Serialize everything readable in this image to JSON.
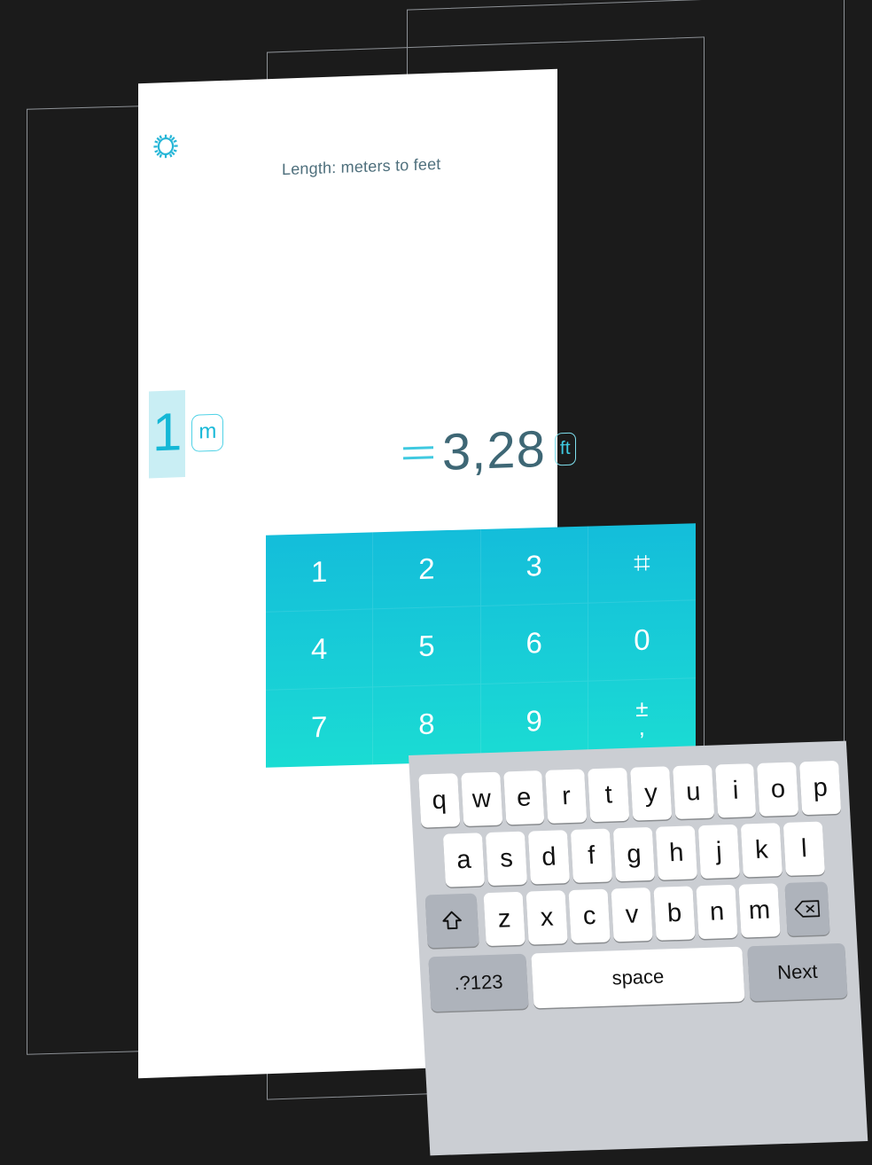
{
  "app": {
    "background_color": "#1b1b1b",
    "accent_color": "#17bcd9",
    "result_color": "#3e6775"
  },
  "header": {
    "settings_icon": "gear-icon",
    "title": "Length: meters to feet"
  },
  "converter": {
    "input": {
      "value": "1",
      "unit": "m",
      "selected": true
    },
    "output": {
      "equals": "=",
      "value": "3,28",
      "unit": "ft"
    }
  },
  "keypad": {
    "keys": [
      {
        "label": "1",
        "name": "keypad-1"
      },
      {
        "label": "2",
        "name": "keypad-2"
      },
      {
        "label": "3",
        "name": "keypad-3"
      },
      {
        "label": "⌗",
        "name": "keypad-hash"
      },
      {
        "label": "4",
        "name": "keypad-4"
      },
      {
        "label": "5",
        "name": "keypad-5"
      },
      {
        "label": "6",
        "name": "keypad-6"
      },
      {
        "label": "0",
        "name": "keypad-0"
      },
      {
        "label": "7",
        "name": "keypad-7"
      },
      {
        "label": "8",
        "name": "keypad-8"
      },
      {
        "label": "9",
        "name": "keypad-9"
      },
      {
        "label": "± ,",
        "name": "keypad-sign-decimal",
        "top": "±",
        "bottom": ","
      }
    ],
    "gradient_top": "#14bdda",
    "gradient_bottom": "#1adcd3"
  },
  "keyboard": {
    "row1": [
      "q",
      "w",
      "e",
      "r",
      "t",
      "y",
      "u",
      "i",
      "o",
      "p"
    ],
    "row2": [
      "a",
      "s",
      "d",
      "f",
      "g",
      "h",
      "j",
      "k",
      "l"
    ],
    "row3": [
      "z",
      "x",
      "c",
      "v",
      "b",
      "n",
      "m"
    ],
    "shift": "shift-icon",
    "delete": "delete-icon",
    "numeric_toggle": ".?123",
    "space": "space",
    "next": "Next",
    "background_color": "#cbced3",
    "modifier_color": "#aeb3bb"
  }
}
